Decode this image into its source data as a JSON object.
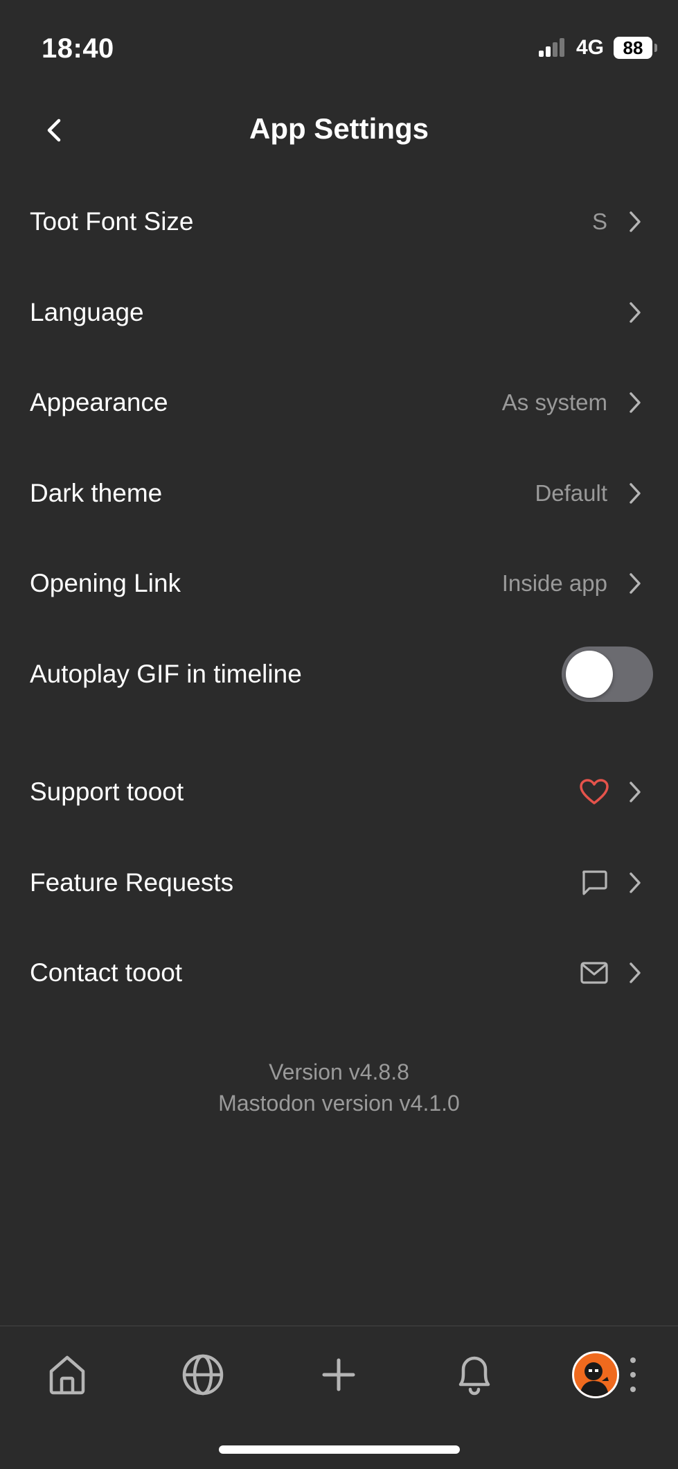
{
  "status_bar": {
    "time": "18:40",
    "network": "4G",
    "battery": "88"
  },
  "header": {
    "title": "App Settings"
  },
  "settings": {
    "font_size": {
      "label": "Toot Font Size",
      "value": "S"
    },
    "language": {
      "label": "Language"
    },
    "appearance": {
      "label": "Appearance",
      "value": "As system"
    },
    "dark_theme": {
      "label": "Dark theme",
      "value": "Default"
    },
    "opening_link": {
      "label": "Opening Link",
      "value": "Inside app"
    },
    "autoplay_gif": {
      "label": "Autoplay GIF in timeline",
      "enabled": false
    },
    "support": {
      "label": "Support tooot",
      "icon": "heart-icon",
      "icon_color": "#e5534b"
    },
    "feature_requests": {
      "label": "Feature Requests",
      "icon": "chat-bubble-icon"
    },
    "contact": {
      "label": "Contact tooot",
      "icon": "envelope-icon"
    }
  },
  "version": {
    "app": "Version v4.8.8",
    "mastodon": "Mastodon version v4.1.0"
  },
  "tab_bar": {
    "items": [
      "home-icon",
      "globe-icon",
      "compose-icon",
      "bell-icon",
      "avatar",
      "more-icon"
    ]
  },
  "colors": {
    "background": "#2b2b2b",
    "secondary_text": "#9a9a9a",
    "toggle_off": "#6b6b70",
    "accent_heart": "#e5534b",
    "avatar_bg": "#f06a1e"
  }
}
